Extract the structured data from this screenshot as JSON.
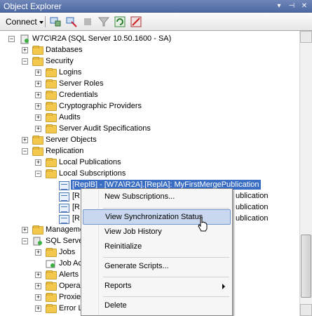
{
  "window": {
    "title": "Object Explorer",
    "controls": [
      "pin-icon",
      "auto-hide-icon",
      "close-icon"
    ]
  },
  "toolbar": {
    "connect_label": "Connect",
    "buttons": [
      "connect-db-icon",
      "disconnect-icon",
      "stop-icon",
      "filter-icon",
      "refresh-icon",
      "register-icon"
    ]
  },
  "tree": {
    "server": "W7C\\R2A (SQL Server 10.50.1600 - SA)",
    "databases": "Databases",
    "security": "Security",
    "logins": "Logins",
    "server_roles": "Server Roles",
    "credentials": "Credentials",
    "crypto_providers": "Cryptographic Providers",
    "audits": "Audits",
    "server_audit_specs": "Server Audit Specifications",
    "server_objects": "Server Objects",
    "replication": "Replication",
    "local_publications": "Local Publications",
    "local_subscriptions": "Local Subscriptions",
    "subscriptions": [
      "[ReplB] - [W7A\\R2A].[ReplA]: MyFirstMergePublication",
      "[R",
      "[R",
      "[R"
    ],
    "subscription_tails": [
      "",
      "ublication",
      "ublication",
      "ublication"
    ],
    "management": "Manageme",
    "sql_agent": "SQL Serve",
    "jobs": "Jobs",
    "job_activity": "Job Ac",
    "alerts": "Alerts",
    "operators": "Opera",
    "proxies": "Proxie",
    "error_logs": "Error L"
  },
  "context_menu": {
    "items": [
      "New Subscriptions...",
      "View Synchronization Status",
      "View Job History",
      "Reinitialize",
      "Generate Scripts...",
      "Reports",
      "Delete"
    ],
    "hovered": "View Synchronization Status"
  },
  "colors": {
    "selection": "#3a6ec4",
    "title_bar": "#5a73a9",
    "menu_hover": "#c9d8ef"
  }
}
